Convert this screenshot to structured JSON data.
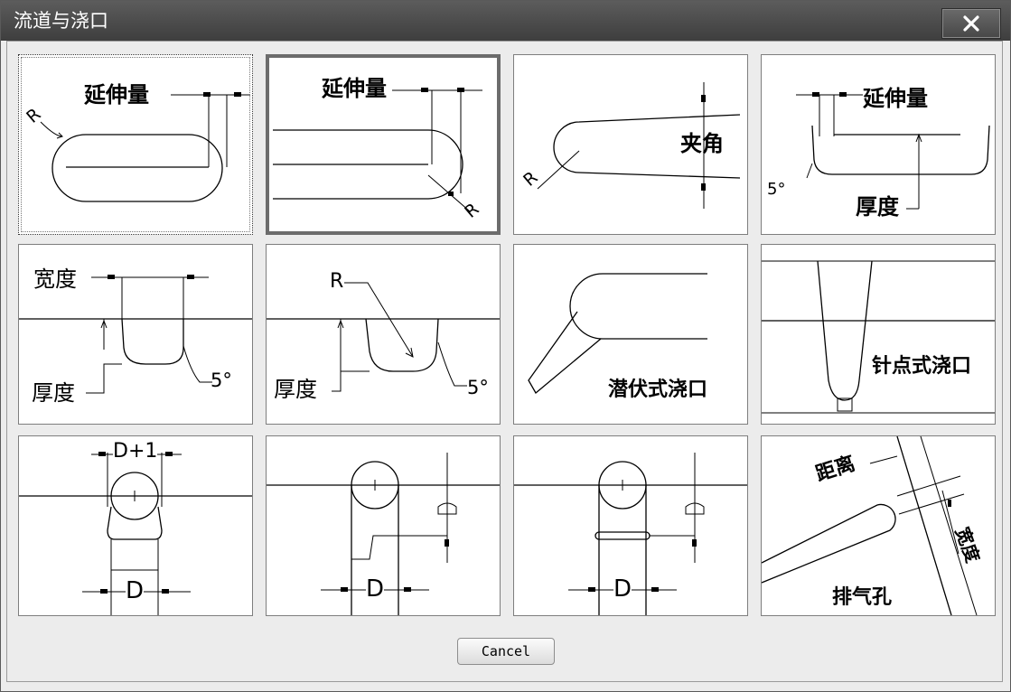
{
  "window": {
    "title": "流道与浇口",
    "close_glyph": "x"
  },
  "tiles": [
    {
      "labels": [
        "延伸量",
        "R"
      ]
    },
    {
      "labels": [
        "延伸量",
        "R"
      ]
    },
    {
      "labels": [
        "夹角",
        "R"
      ]
    },
    {
      "labels": [
        "延伸量",
        "5°",
        "厚度"
      ]
    },
    {
      "labels": [
        "宽度",
        "厚度",
        "5°"
      ]
    },
    {
      "labels": [
        "R",
        "厚度",
        "5°"
      ]
    },
    {
      "labels": [
        "潜伏式浇口"
      ]
    },
    {
      "labels": [
        "针点式浇口"
      ]
    },
    {
      "labels": [
        "D+1",
        "D"
      ]
    },
    {
      "labels": [
        "D"
      ]
    },
    {
      "labels": [
        "D"
      ]
    },
    {
      "labels": [
        "距离",
        "宽度",
        "排气孔"
      ]
    }
  ],
  "buttons": {
    "cancel": "Cancel"
  }
}
